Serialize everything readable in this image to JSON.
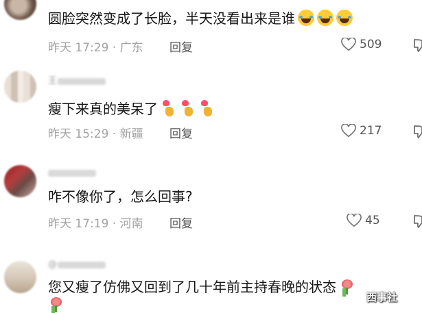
{
  "comments": [
    {
      "username": "",
      "text": "圆脸突然变成了长脸，半天没看出来是谁",
      "emoji": "laughing-with-tears-emoji",
      "emoji_count": 3,
      "time": "昨天 17:29",
      "location": "广东",
      "reply_label": "回复",
      "likes": "509"
    },
    {
      "username": "王",
      "text": "瘦下来真的美呆了",
      "emoji": "finger-heart-emoji",
      "emoji_count": 3,
      "time": "昨天 15:29",
      "location": "新疆",
      "reply_label": "回复",
      "likes": "217"
    },
    {
      "username": "",
      "text": "咋不像你了，怎么回事?",
      "time": "昨天 17:19",
      "location": "河南",
      "reply_label": "回复",
      "likes": "45"
    },
    {
      "username": "@",
      "text": "您又瘦了仿佛又回到了几十年前主持春晚的状态",
      "emoji": "rose-emoji",
      "emoji_count": 2
    }
  ],
  "watermark": "西事社",
  "colors": {
    "text": "#161616",
    "meta": "#a3a3a3",
    "action": "#555555",
    "background": "#ffffff"
  }
}
